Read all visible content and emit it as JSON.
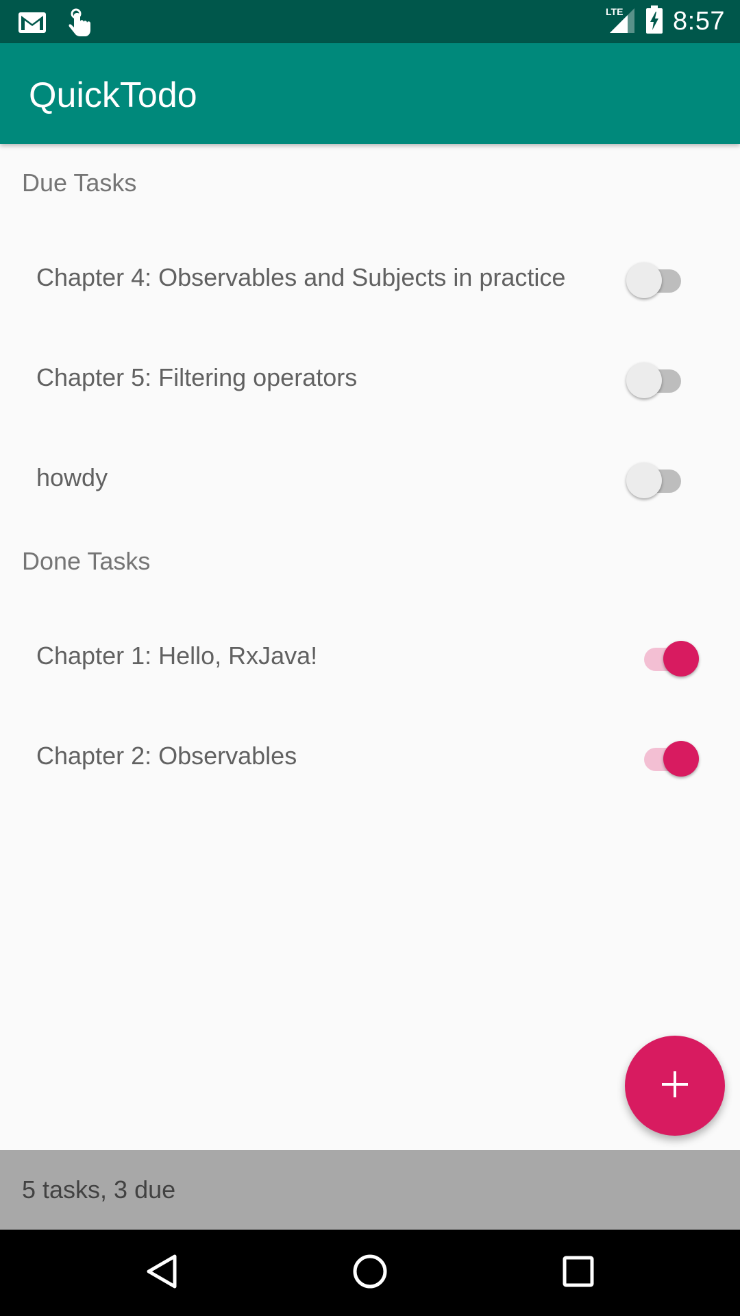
{
  "status_bar": {
    "time": "8:57",
    "network": "LTE",
    "icons": [
      "gmail-icon",
      "touch-icon",
      "signal-icon",
      "battery-charging-icon"
    ]
  },
  "app_bar": {
    "title": "QuickTodo"
  },
  "sections": {
    "due": {
      "header": "Due Tasks",
      "tasks": [
        {
          "label": "Chapter 4: Observables and Subjects in practice",
          "done": false
        },
        {
          "label": "Chapter 5: Filtering operators",
          "done": false
        },
        {
          "label": "howdy",
          "done": false
        }
      ]
    },
    "done": {
      "header": "Done Tasks",
      "tasks": [
        {
          "label": "Chapter 1: Hello, RxJava!",
          "done": true
        },
        {
          "label": "Chapter 2: Observables",
          "done": true
        }
      ]
    }
  },
  "fab": {
    "icon": "plus-icon"
  },
  "footer": {
    "summary": "5 tasks, 3 due"
  },
  "nav_bar": {
    "buttons": [
      "back-icon",
      "home-icon",
      "recents-icon"
    ]
  },
  "colors": {
    "status_bar": "#00574b",
    "primary": "#00897b",
    "accent": "#d81b60"
  }
}
